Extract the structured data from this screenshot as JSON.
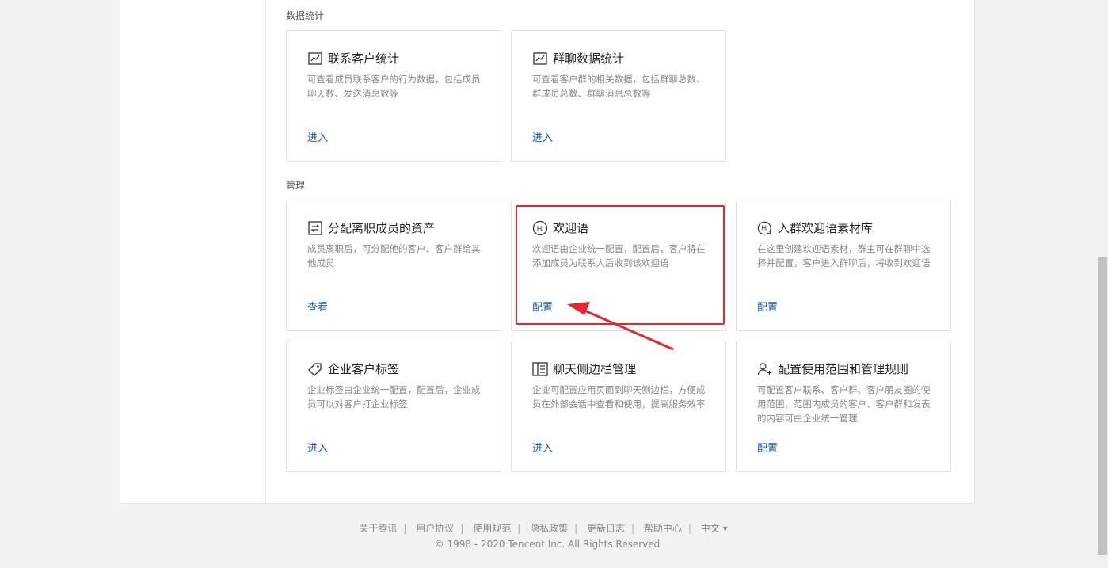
{
  "sections": {
    "stats_title": "数据统计",
    "manage_title": "管理"
  },
  "cards": {
    "contact_stats": {
      "icon": "chart-icon",
      "title": "联系客户统计",
      "desc": "可查看成员联系客户的行为数据，包括成员聊天数、发送消息数等",
      "link": "进入"
    },
    "group_stats": {
      "icon": "chart-icon",
      "title": "群聊数据统计",
      "desc": "可查看客户群的相关数据，包括群聊总数、群成员总数、群聊消息总数等",
      "link": "进入"
    },
    "assign_assets": {
      "icon": "transfer-icon",
      "title": "分配离职成员的资产",
      "desc": "成员离职后，可分配他的客户、客户群给其他成员",
      "link": "查看"
    },
    "welcome": {
      "icon": "hi-icon",
      "title": "欢迎语",
      "desc": "欢迎语由企业统一配置，配置后，客户将在添加成员为联系人后收到该欢迎语",
      "link": "配置"
    },
    "group_welcome": {
      "icon": "hi-chat-icon",
      "title": "入群欢迎语素材库",
      "desc": "在这里创建欢迎语素材，群主可在群聊中选择并配置，客户进入群聊后，将收到欢迎语",
      "link": "配置"
    },
    "tags": {
      "icon": "tag-icon",
      "title": "企业客户标签",
      "desc": "企业标签由企业统一配置，配置后，企业成员可以对客户打企业标签",
      "link": "进入"
    },
    "sidebar": {
      "icon": "sidebar-icon",
      "title": "聊天侧边栏管理",
      "desc": "企业可配置应用页面到聊天侧边栏，方便成员在外部会话中查看和使用，提高服务效率",
      "link": "进入"
    },
    "scope": {
      "icon": "add-user-icon",
      "title": "配置使用范围和管理规则",
      "desc": "可配置客户联系、客户群、客户朋友圈的使用范围，范围内成员的客户、客户群和发表的内容可由企业统一管理",
      "link": "配置"
    }
  },
  "footer": {
    "links": [
      "关于腾讯",
      "用户协议",
      "使用规范",
      "隐私政策",
      "更新日志",
      "帮助中心"
    ],
    "language": "中文 ▾",
    "copyright": "© 1998 - 2020 Tencent Inc. All Rights Reserved"
  },
  "colors": {
    "link": "#1d5a9c",
    "annotation": "#e8262c"
  }
}
